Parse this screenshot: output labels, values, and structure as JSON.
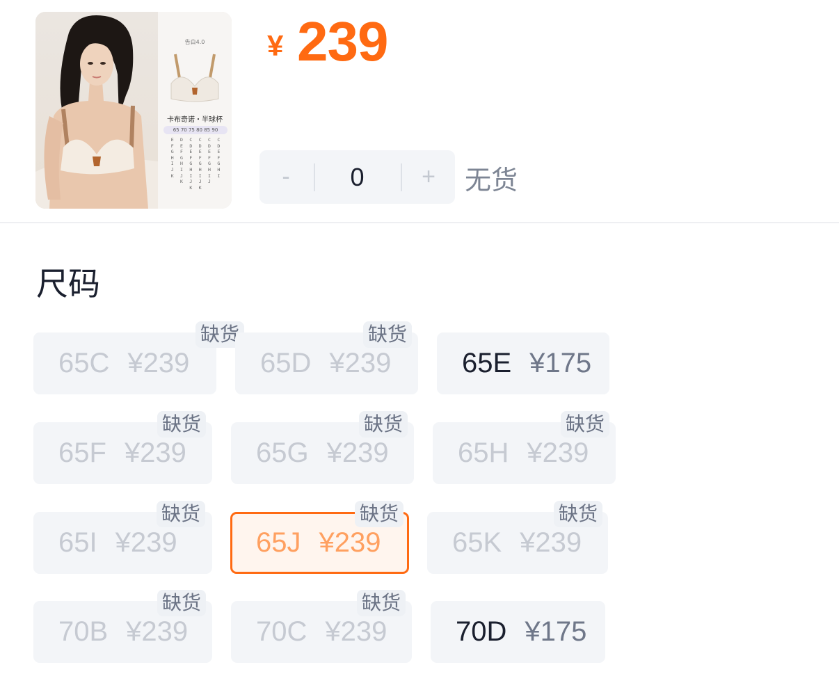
{
  "product": {
    "image_alt": "product-image",
    "thumb_series": "告白4.0",
    "thumb_name": "卡布奇诺・半球杯",
    "thumb_sizes": "65 70 75 80 85 90",
    "thumb_cups": [
      [
        "E",
        "D",
        "C",
        "C",
        "C",
        "C"
      ],
      [
        "F",
        "E",
        "D",
        "D",
        "D",
        "D"
      ],
      [
        "G",
        "F",
        "E",
        "E",
        "E",
        "E"
      ],
      [
        "H",
        "G",
        "F",
        "F",
        "F",
        "F"
      ],
      [
        "I",
        "H",
        "G",
        "G",
        "G",
        "G"
      ],
      [
        "J",
        "I",
        "H",
        "H",
        "H",
        "H"
      ],
      [
        "K",
        "J",
        "I",
        "I",
        "I",
        "I"
      ],
      [
        "",
        "K",
        "J",
        "J",
        "J",
        ""
      ],
      [
        "",
        "",
        "K",
        "K",
        "",
        ""
      ]
    ]
  },
  "price": {
    "currency": "¥",
    "amount": "239"
  },
  "quantity": {
    "minus": "-",
    "value": "0",
    "plus": "+",
    "status": "无货"
  },
  "section": {
    "title": "尺码"
  },
  "colors": {
    "accent": "#ff6a12",
    "chip_bg": "#f3f5f8"
  },
  "sizes": [
    {
      "size": "65C",
      "price": "¥239",
      "badge": "缺货"
    },
    {
      "size": "65D",
      "price": "¥239",
      "badge": "缺货"
    },
    {
      "size": "65E",
      "price": "¥175",
      "badge": ""
    },
    {
      "size": "65F",
      "price": "¥239",
      "badge": "缺货"
    },
    {
      "size": "65G",
      "price": "¥239",
      "badge": "缺货"
    },
    {
      "size": "65H",
      "price": "¥239",
      "badge": "缺货"
    },
    {
      "size": "65I",
      "price": "¥239",
      "badge": "缺货"
    },
    {
      "size": "65J",
      "price": "¥239",
      "badge": "缺货"
    },
    {
      "size": "65K",
      "price": "¥239",
      "badge": "缺货"
    },
    {
      "size": "70B",
      "price": "¥239",
      "badge": "缺货"
    },
    {
      "size": "70C",
      "price": "¥239",
      "badge": "缺货"
    },
    {
      "size": "70D",
      "price": "¥175",
      "badge": ""
    }
  ]
}
